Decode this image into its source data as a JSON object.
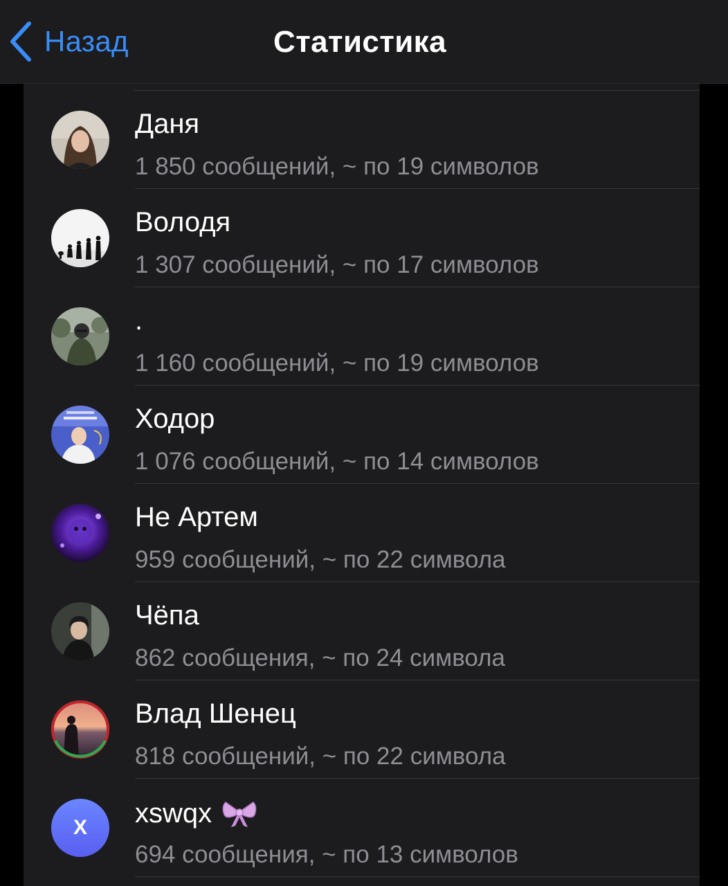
{
  "navbar": {
    "back_label": "Назад",
    "title": "Статистика",
    "accent_color": "#3a8df7"
  },
  "list": {
    "rows": [
      {
        "name": "Даня",
        "stats": "1 850 сообщений, ~ по 19 символов",
        "avatar": "photo-girl-portrait"
      },
      {
        "name": "Володя",
        "stats": "1 307 сообщений, ~ по 17 символов",
        "avatar": "evolution-silhouettes"
      },
      {
        "name": ".",
        "stats": "1 160 сообщений, ~ по 19 символов",
        "avatar": "photo-soldier"
      },
      {
        "name": "Ходор",
        "stats": "1 076 сообщений, ~ по 14 символов",
        "avatar": "photo-blue-poster"
      },
      {
        "name": "Не Артем",
        "stats": "959 сообщений, ~ по 22 символа",
        "avatar": "photo-purple-glow"
      },
      {
        "name": "Чёпа",
        "stats": "862 сообщения, ~ по 24 символа",
        "avatar": "photo-dark-portrait"
      },
      {
        "name": "Влад Шенец",
        "stats": "818 сообщений, ~ по 22 символа",
        "avatar": "photo-sunset-silhouette"
      },
      {
        "name": "xswqx",
        "stats": "694 сообщения, ~ по 13 символов",
        "avatar": "initial-x",
        "initial": "X",
        "emoji": "bow-emoji"
      }
    ]
  }
}
